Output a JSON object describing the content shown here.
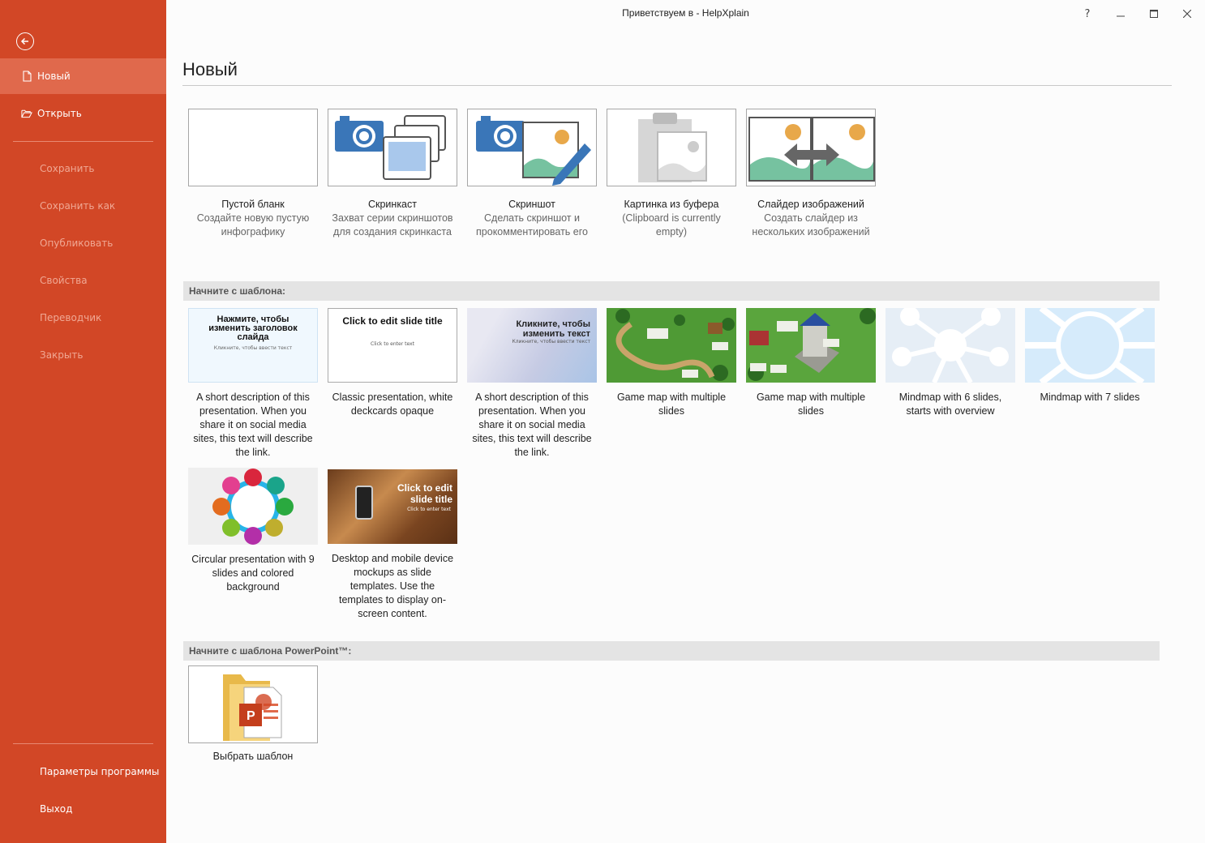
{
  "window": {
    "title": "Приветствуем в - HelpXplain",
    "help": "?",
    "minimize": "—",
    "maximize": "☐",
    "close": "✕"
  },
  "sidebar": {
    "items": [
      {
        "label": "Новый",
        "state": "active",
        "icon": "file-icon"
      },
      {
        "label": "Открыть",
        "state": "enabled",
        "icon": "folder-open-icon"
      },
      {
        "label": "Сохранить",
        "state": "disabled"
      },
      {
        "label": "Сохранить как",
        "state": "disabled"
      },
      {
        "label": "Опубликовать",
        "state": "disabled"
      },
      {
        "label": "Свойства",
        "state": "disabled"
      },
      {
        "label": "Переводчик",
        "state": "disabled"
      },
      {
        "label": "Закрыть",
        "state": "disabled"
      }
    ],
    "bottom": [
      {
        "label": "Параметры программы"
      },
      {
        "label": "Выход"
      }
    ]
  },
  "main": {
    "title": "Новый",
    "new_items": [
      {
        "name": "Пустой бланк",
        "desc": "Создайте новую пустую инфографику"
      },
      {
        "name": "Скринкаст",
        "desc": "Захват серии скриншотов для создания скринкаста"
      },
      {
        "name": "Скриншот",
        "desc": "Сделать скриншот и прокомментировать его"
      },
      {
        "name": "Картинка из буфера",
        "desc": "(Clipboard is currently empty)"
      },
      {
        "name": "Слайдер изображений",
        "desc": "Создать слайдер из нескольких изображений"
      }
    ],
    "templates_header": "Начните с шаблона:",
    "templates": [
      {
        "label": "A short description of this presentation. When you share it on social media sites, this text will describe the link.",
        "thumb_title": "Нажмите, чтобы изменить заголовок слайда",
        "thumb_sub": "Кликните, чтобы ввести текст"
      },
      {
        "label": "Classic presentation, white deckcards opaque",
        "thumb_title": "Click to edit slide title",
        "thumb_sub": "Click to enter text"
      },
      {
        "label": "A short description of this presentation. When you share it on social media sites, this text will describe the link.",
        "thumb_title": "Кликните, чтобы изменить текст",
        "thumb_sub": "Кликните, чтобы ввести текст"
      },
      {
        "label": "Game map with multiple slides"
      },
      {
        "label": "Game map with multiple slides"
      },
      {
        "label": "Mindmap with 6 slides, starts with overview"
      },
      {
        "label": "Mindmap with 7 slides"
      },
      {
        "label": "Circular presentation with 9 slides and colored background"
      },
      {
        "label": "Desktop and mobile device mockups as slide templates. Use the templates to display on-screen content.",
        "thumb_title": "Click to edit slide title",
        "thumb_sub": "Click to enter text"
      }
    ],
    "ppt_header": "Начните с шаблона PowerPoint™:",
    "ppt_item": {
      "label": "Выбрать шаблон"
    }
  }
}
